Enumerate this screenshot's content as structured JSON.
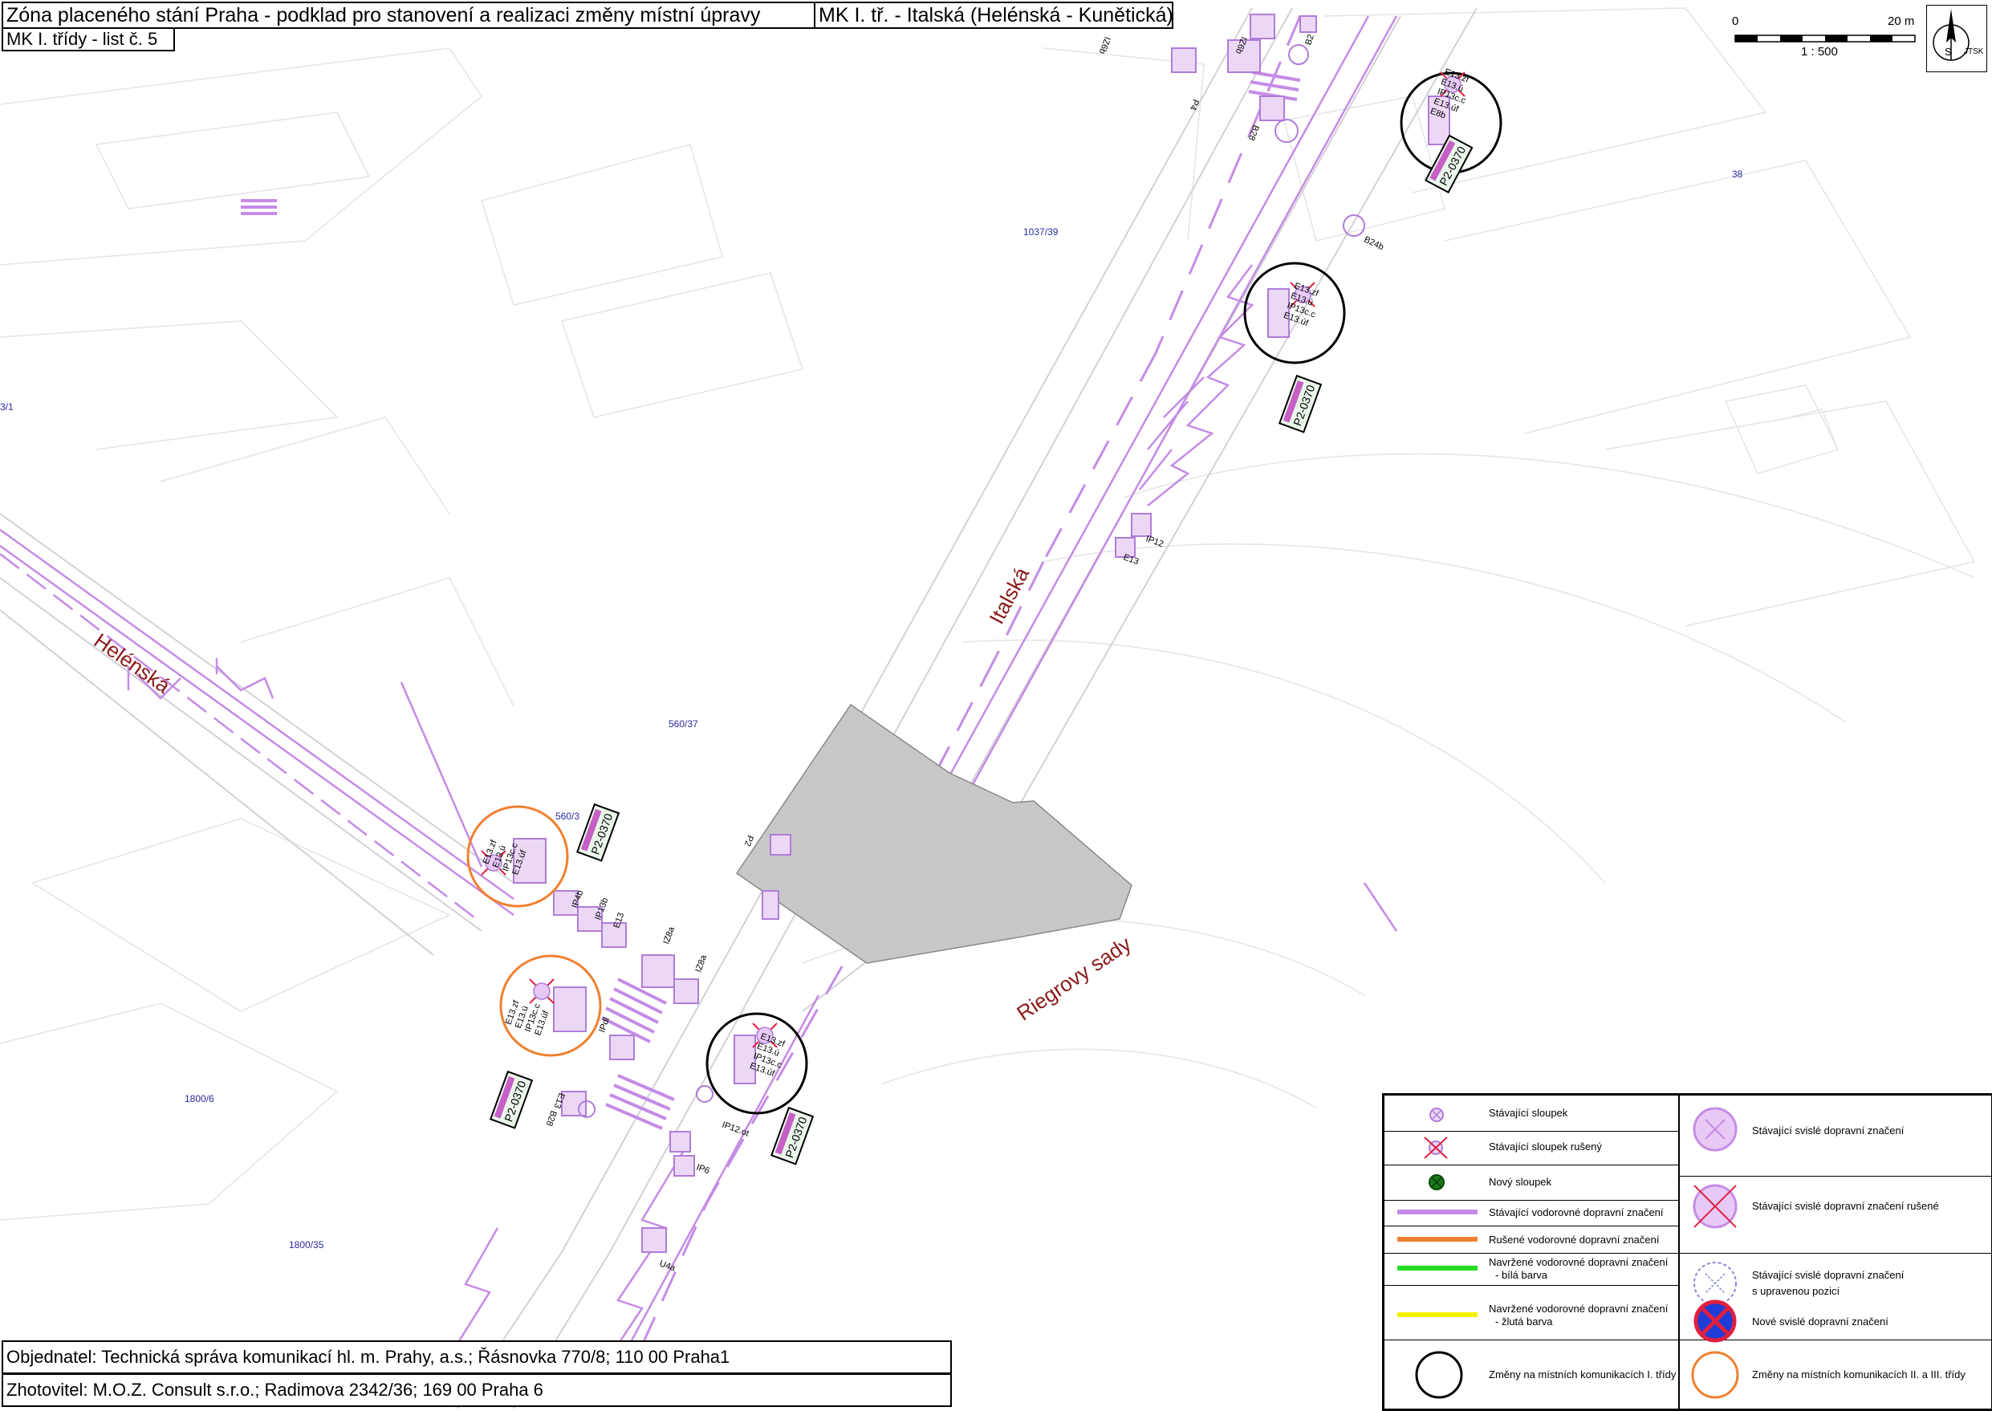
{
  "title": {
    "main": "Zóna placeného stání Praha - podklad pro stanovení a realizaci změny místní úpravy",
    "section": "MK I. tř. - Italská (Helénská - Kunětická)",
    "sheet": "MK I. třídy - list č. 5"
  },
  "footer": {
    "client": "Objednatel: Technická správa komunikací hl. m. Prahy, a.s.; Řásnovka 770/8; 110 00 Praha1",
    "contractor": "Zhotovitel: M.O.Z. Consult s.r.o.; Radimova 2342/36; 169 00 Praha 6"
  },
  "scale": {
    "start": "0",
    "end": "20 m",
    "ratio": "1 : 500"
  },
  "compass": {
    "north": "S",
    "system": "JTSK"
  },
  "streets": {
    "italska": "Italská",
    "helenska": "Helénská",
    "riegrovy": "Riegrovy sady"
  },
  "parcels": [
    "1037/39",
    "38",
    "560/37",
    "560/3",
    "1800/6",
    "1800/35",
    "3/1"
  ],
  "sign_labels": {
    "b2": "B2",
    "b28_top": "B28",
    "p4": "P4",
    "iz6b_1": "IZ6b",
    "iz6b_2": "IZ6b",
    "b24b": "B24b",
    "ip12": "IP12",
    "e13": "E13",
    "p2": "P2",
    "iz8a_1": "IZ8a",
    "iz8a_2": "IZ8a",
    "ip4b": "IP4b",
    "ip13b": "IP13b",
    "e13_mid": "E13",
    "e13_low": "E13",
    "b28_low": "B28",
    "ip12_ot": "IP12.ot",
    "ip6": "IP6",
    "u4a": "U4a",
    "ipdl": "IPdl",
    "group_lines": [
      "E13.zf",
      "E13.ú",
      "IP13c.c",
      "E13.úf"
    ],
    "group_top_lines": [
      "E13.zf",
      "E13.ú",
      "IP13c.c",
      "E13.úf",
      "E8b"
    ]
  },
  "parking_tag": "P2-0370",
  "legend": {
    "left": [
      {
        "label": "Stávající sloupek",
        "symbol": "existing-post"
      },
      {
        "label": "Stávající sloupek rušený",
        "symbol": "removed-post"
      },
      {
        "label": "Nový sloupek",
        "symbol": "new-post"
      },
      {
        "label": "Stávající vodorovné dopravní značení",
        "color": "#c68be6"
      },
      {
        "label": "Rušené vodorovné dopravní značení",
        "color": "#f08030"
      },
      {
        "label": "Navržené vodorovné dopravní značení - bílá barva",
        "lines": [
          "Navržené vodorovné dopravní značení",
          "- bílá barva"
        ],
        "color": "#22dd22"
      },
      {
        "label": "Navržené vodorovné dopravní značení - žlutá barva",
        "lines": [
          "Navržené vodorovné dopravní značení",
          "- žlutá barva"
        ],
        "color": "#f5f000"
      },
      {
        "label": "Změny na místních komunikacích I. třídy",
        "symbol": "black-circle"
      }
    ],
    "right": [
      {
        "label": "Stávající svislé dopravní značení",
        "symbol": "existing-sign"
      },
      {
        "label": "Stávající svislé dopravní značení rušené",
        "symbol": "removed-sign"
      },
      {
        "label": "Stávající svislé dopravní značení s upravenou pozicí",
        "lines": [
          "Stávající svislé dopravní značení",
          "s upravenou pozicí"
        ],
        "symbol": "moved-sign"
      },
      {
        "label": "Nové svislé dopravní značení",
        "symbol": "new-sign"
      },
      {
        "label": "Změny na místních komunikacích II. a III. třídy",
        "symbol": "orange-circle"
      }
    ]
  },
  "colors": {
    "marking": "#c68be6",
    "removed": "#e02040",
    "orange": "#f08030",
    "green": "#22dd22",
    "yellow": "#f5f000",
    "street_label": "#8b1a1a",
    "parcel_label": "#2a2aa0",
    "building": "#c8c8c8"
  }
}
